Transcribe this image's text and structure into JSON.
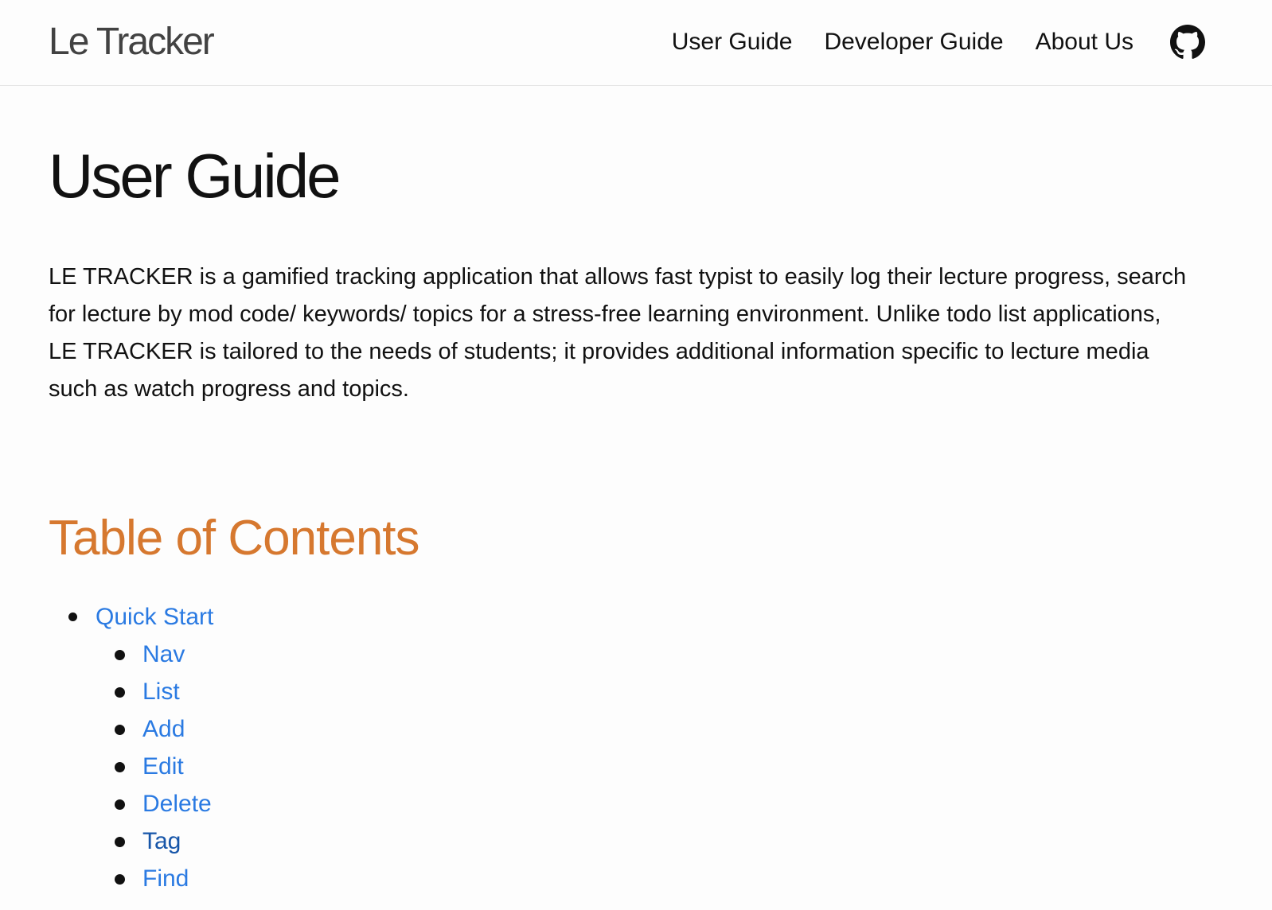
{
  "header": {
    "site_title": "Le Tracker",
    "nav": [
      {
        "label": "User Guide"
      },
      {
        "label": "Developer Guide"
      },
      {
        "label": "About Us"
      }
    ],
    "github_icon": "github-icon"
  },
  "main": {
    "title": "User Guide",
    "intro": "LE TRACKER is a gamified tracking application that allows fast typist to easily log their lecture progress, search for lecture by mod code/ keywords/ topics for a stress-free learning environment. Unlike todo list applications, LE TRACKER is tailored to the needs of students; it provides additional information specific to lecture media such as watch progress and topics.",
    "toc_heading": "Table of Contents",
    "toc": {
      "quick_start": "Quick Start",
      "items": [
        {
          "label": "Nav"
        },
        {
          "label": "List"
        },
        {
          "label": "Add"
        },
        {
          "label": "Edit"
        },
        {
          "label": "Delete"
        },
        {
          "label": "Tag"
        },
        {
          "label": "Find"
        }
      ]
    }
  },
  "colors": {
    "background": "#fdfdfd",
    "link": "#2a7ae2",
    "link_visited": "#1756a9",
    "toc_heading": "#d6782f",
    "site_title": "#424242"
  }
}
